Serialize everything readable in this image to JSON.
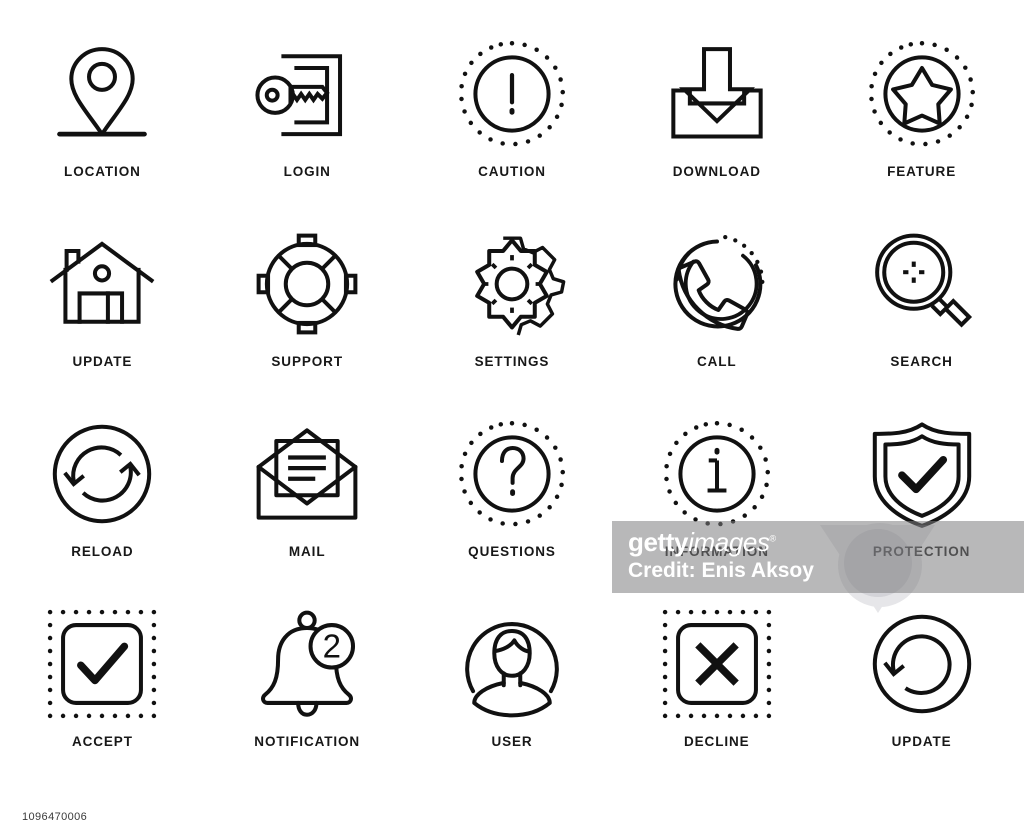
{
  "page": {
    "background_color": "#ffffff",
    "stroke_color": "#111111",
    "label_color": "#181818",
    "image_id": "1096470006"
  },
  "watermark": {
    "logo_bold": "getty",
    "logo_light": "images",
    "logo_mark": "®",
    "credit": "Credit: Enis Aksoy",
    "band_color": "#7d7d80"
  },
  "grid": {
    "columns": 5,
    "rows": 4,
    "icons": [
      {
        "label": "LOCATION",
        "icon": "map-pin-icon"
      },
      {
        "label": "LOGIN",
        "icon": "key-door-icon"
      },
      {
        "label": "CAUTION",
        "icon": "exclamation-circle-dotted-icon"
      },
      {
        "label": "DOWNLOAD",
        "icon": "download-tray-icon"
      },
      {
        "label": "FEATURE",
        "icon": "star-circle-dotted-icon"
      },
      {
        "label": "UPDATE",
        "icon": "house-icon"
      },
      {
        "label": "SUPPORT",
        "icon": "life-buoy-icon"
      },
      {
        "label": "SETTINGS",
        "icon": "gear-icon"
      },
      {
        "label": "CALL",
        "icon": "phone-handset-circle-icon"
      },
      {
        "label": "SEARCH",
        "icon": "magnifier-icon"
      },
      {
        "label": "RELOAD",
        "icon": "refresh-circle-icon"
      },
      {
        "label": "MAIL",
        "icon": "open-envelope-icon"
      },
      {
        "label": "QUESTIONS",
        "icon": "question-circle-dotted-icon"
      },
      {
        "label": "INFORMATION",
        "icon": "info-circle-dotted-icon"
      },
      {
        "label": "PROTECTION",
        "icon": "shield-check-icon"
      },
      {
        "label": "ACCEPT",
        "icon": "checkmark-square-dotted-icon"
      },
      {
        "label": "NOTIFICATION",
        "icon": "bell-badge-icon",
        "badge": "2"
      },
      {
        "label": "USER",
        "icon": "user-avatar-icon"
      },
      {
        "label": "DECLINE",
        "icon": "cross-square-dotted-icon"
      },
      {
        "label": "UPDATE",
        "icon": "rotate-circle-icon"
      }
    ]
  }
}
